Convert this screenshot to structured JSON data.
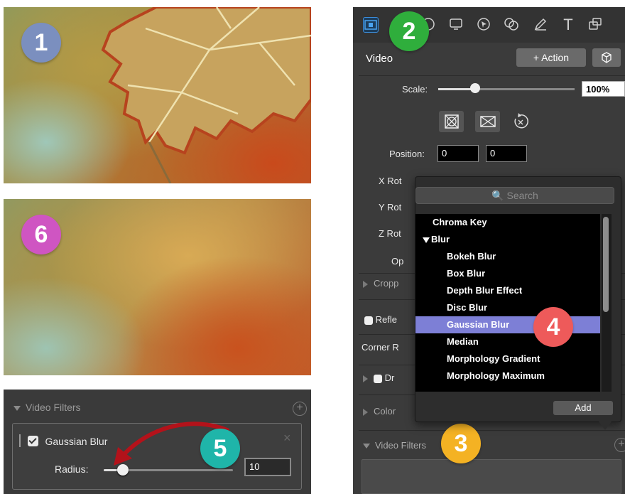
{
  "badges": {
    "b1": "1",
    "b2": "2",
    "b3": "3",
    "b4": "4",
    "b5": "5",
    "b6": "6"
  },
  "colors": {
    "badge1": "#7b8fbf",
    "badge2": "#2fae3c",
    "badge3": "#f4b223",
    "badge4": "#ee5a5a",
    "badge5": "#1fb5a9",
    "badge6": "#cf55c2",
    "highlight": "#7d7fd6"
  },
  "filters_panel": {
    "header": "Video Filters",
    "filter_name": "Gaussian Blur",
    "radius_label": "Radius:",
    "radius_value": "10",
    "close_glyph": "×",
    "add_glyph": "+"
  },
  "inspector": {
    "tools": [
      "film-icon",
      "audio-icon",
      "screen-icon",
      "cursor-icon",
      "circles-icon",
      "pen-icon",
      "text-icon",
      "callout-icon"
    ],
    "text_tool_glyph": "T",
    "section": "Video",
    "action_button": "+ Action",
    "scale_label": "Scale:",
    "scale_value": "100%",
    "position_label": "Position:",
    "position_x": "0",
    "position_y": "0",
    "x_rot": "X Rot",
    "y_rot": "Y Rot",
    "z_rot": "Z Rot",
    "opacity": "Op",
    "crop": "Cropp",
    "reflection": "Refle",
    "corner": "Corner R",
    "drop": "Dr",
    "color": "Color",
    "video_filters": "Video Filters"
  },
  "popover": {
    "search_placeholder": "Search",
    "add_button": "Add",
    "items": [
      {
        "label": "Chroma Key",
        "level": 0
      },
      {
        "label": "Blur",
        "level": 0,
        "expanded": true
      },
      {
        "label": "Bokeh Blur",
        "level": 1
      },
      {
        "label": "Box Blur",
        "level": 1
      },
      {
        "label": "Depth Blur Effect",
        "level": 1
      },
      {
        "label": "Disc Blur",
        "level": 1
      },
      {
        "label": "Gaussian Blur",
        "level": 1,
        "selected": true
      },
      {
        "label": "Median",
        "level": 1
      },
      {
        "label": "Morphology Gradient",
        "level": 1
      },
      {
        "label": "Morphology Maximum",
        "level": 1
      }
    ],
    "scroll_fraction": 0.55
  }
}
